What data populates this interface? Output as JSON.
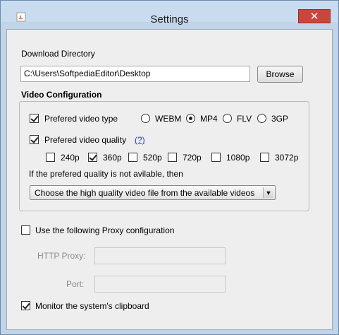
{
  "window": {
    "title": "Settings",
    "icon": "java-cup-icon",
    "close_glyph": "✕"
  },
  "download": {
    "label": "Download Directory",
    "path": "C:\\Users\\SoftpediaEditor\\Desktop",
    "browse_label": "Browse"
  },
  "video": {
    "section_label": "Video Configuration",
    "type": {
      "label": "Prefered video type",
      "checked": true,
      "options": [
        "WEBM",
        "MP4",
        "FLV",
        "3GP"
      ],
      "selected": "MP4"
    },
    "quality": {
      "label": "Prefered video quality",
      "help_link": "(?)",
      "checked": true,
      "options": [
        {
          "label": "240p",
          "checked": false
        },
        {
          "label": "360p",
          "checked": true
        },
        {
          "label": "520p",
          "checked": false
        },
        {
          "label": "720p",
          "checked": false
        },
        {
          "label": "1080p",
          "checked": false
        },
        {
          "label": "3072p",
          "checked": false
        }
      ]
    },
    "fallback_label": "If the prefered quality is not avilable, then",
    "fallback_value": "Choose the high quality video file from the available videos"
  },
  "proxy": {
    "label": "Use the following Proxy configuration",
    "checked": false,
    "http_label": "HTTP Proxy:",
    "http_value": "",
    "port_label": "Port:",
    "port_value": ""
  },
  "clipboard": {
    "label": "Monitor the system's clipboard",
    "checked": true
  }
}
